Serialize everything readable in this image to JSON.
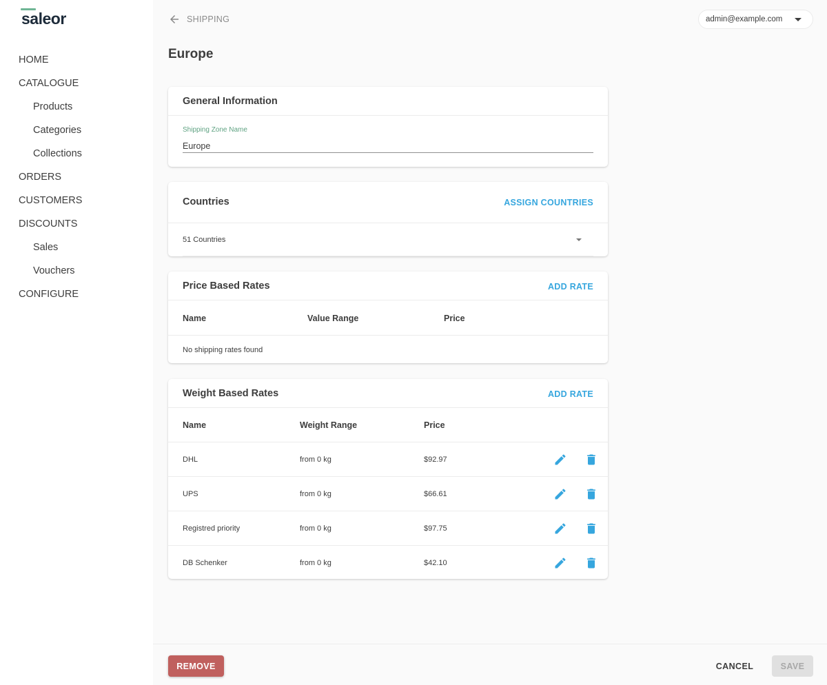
{
  "brand": {
    "logo_text": "saleor"
  },
  "sidebar": {
    "items": [
      {
        "label": "HOME"
      },
      {
        "label": "CATALOGUE"
      },
      {
        "label": "Products"
      },
      {
        "label": "Categories"
      },
      {
        "label": "Collections"
      },
      {
        "label": "ORDERS"
      },
      {
        "label": "CUSTOMERS"
      },
      {
        "label": "DISCOUNTS"
      },
      {
        "label": "Sales"
      },
      {
        "label": "Vouchers"
      },
      {
        "label": "CONFIGURE"
      }
    ]
  },
  "header": {
    "back_label": "SHIPPING",
    "user_email": "admin@example.com",
    "page_title": "Europe"
  },
  "general": {
    "title": "General Information",
    "field_label": "Shipping Zone Name",
    "field_value": "Europe"
  },
  "countries": {
    "title": "Countries",
    "action": "ASSIGN COUNTRIES",
    "summary": "51 Countries"
  },
  "price_rates": {
    "title": "Price Based Rates",
    "action": "ADD RATE",
    "columns": [
      "Name",
      "Value Range",
      "Price"
    ],
    "empty_text": "No shipping rates found"
  },
  "weight_rates": {
    "title": "Weight Based Rates",
    "action": "ADD RATE",
    "columns": [
      "Name",
      "Weight Range",
      "Price"
    ],
    "rows": [
      {
        "name": "DHL",
        "range": "from 0 kg",
        "price": "$92.97"
      },
      {
        "name": "UPS",
        "range": "from 0 kg",
        "price": "$66.61"
      },
      {
        "name": "Registred priority",
        "range": "from 0 kg",
        "price": "$97.75"
      },
      {
        "name": "DB Schenker",
        "range": "from 0 kg",
        "price": "$42.10"
      }
    ]
  },
  "footer": {
    "remove_label": "REMOVE",
    "cancel_label": "CANCEL",
    "save_label": "SAVE"
  },
  "colors": {
    "accent": "#36a6de",
    "danger": "#c0605e",
    "brand_green": "#6fb595"
  }
}
